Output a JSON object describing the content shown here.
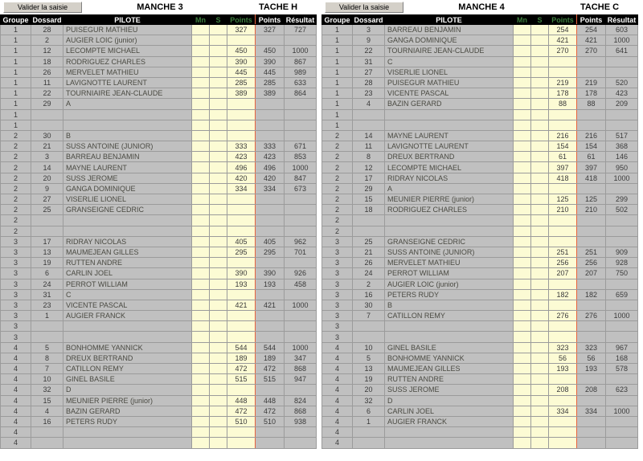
{
  "toolbar": {
    "validate_label": "Valider la saisie",
    "left_manche": "MANCHE 3",
    "left_tache": "TACHE H",
    "right_manche": "MANCHE 4",
    "right_tache": "TACHE C"
  },
  "columns": {
    "groupe": "Groupe",
    "dossard": "Dossard",
    "pilote": "PILOTE",
    "mn": "Mn",
    "s": "S",
    "points_entry": "Points",
    "points": "Points",
    "resultat": "Résultat"
  },
  "colors": {
    "header_bg": "#000000",
    "header_text": "#ffffff",
    "header_editable_text": "#3f7f3f",
    "cell_bg": "#c0c0c0",
    "input_bg": "#fcfbd4",
    "input_border": "#e8623c",
    "grid_line": "#9b9b9b",
    "button_face": "#d4d0c8"
  },
  "left_table": {
    "rows": [
      {
        "groupe": "1",
        "dossard": "28",
        "pilote": "PUISEGUR MATHIEU",
        "mn": "",
        "s": "",
        "points_entry": "327",
        "points": "327",
        "resultat": "727"
      },
      {
        "groupe": "1",
        "dossard": "2",
        "pilote": "AUGIER LOIC  (junior)",
        "mn": "",
        "s": "",
        "points_entry": "",
        "points": "",
        "resultat": ""
      },
      {
        "groupe": "1",
        "dossard": "12",
        "pilote": "LECOMPTE MICHAEL",
        "mn": "",
        "s": "",
        "points_entry": "450",
        "points": "450",
        "resultat": "1000"
      },
      {
        "groupe": "1",
        "dossard": "18",
        "pilote": "RODRIGUEZ CHARLES",
        "mn": "",
        "s": "",
        "points_entry": "390",
        "points": "390",
        "resultat": "867"
      },
      {
        "groupe": "1",
        "dossard": "26",
        "pilote": "MERVELET MATHIEU",
        "mn": "",
        "s": "",
        "points_entry": "445",
        "points": "445",
        "resultat": "989"
      },
      {
        "groupe": "1",
        "dossard": "11",
        "pilote": "LAVIGNOTTE LAURENT",
        "mn": "",
        "s": "",
        "points_entry": "285",
        "points": "285",
        "resultat": "633"
      },
      {
        "groupe": "1",
        "dossard": "22",
        "pilote": "TOURNIAIRE JEAN-CLAUDE",
        "mn": "",
        "s": "",
        "points_entry": "389",
        "points": "389",
        "resultat": "864"
      },
      {
        "groupe": "1",
        "dossard": "29",
        "pilote": "A",
        "mn": "",
        "s": "",
        "points_entry": "",
        "points": "",
        "resultat": ""
      },
      {
        "groupe": "1",
        "dossard": "",
        "pilote": "",
        "mn": "",
        "s": "",
        "points_entry": "",
        "points": "",
        "resultat": ""
      },
      {
        "groupe": "1",
        "dossard": "",
        "pilote": "",
        "mn": "",
        "s": "",
        "points_entry": "",
        "points": "",
        "resultat": ""
      },
      {
        "groupe": "2",
        "dossard": "30",
        "pilote": "B",
        "mn": "",
        "s": "",
        "points_entry": "",
        "points": "",
        "resultat": ""
      },
      {
        "groupe": "2",
        "dossard": "21",
        "pilote": "SUSS ANTOINE (JUNIOR)",
        "mn": "",
        "s": "",
        "points_entry": "333",
        "points": "333",
        "resultat": "671"
      },
      {
        "groupe": "2",
        "dossard": "3",
        "pilote": "BARREAU BENJAMIN",
        "mn": "",
        "s": "",
        "points_entry": "423",
        "points": "423",
        "resultat": "853"
      },
      {
        "groupe": "2",
        "dossard": "14",
        "pilote": "MAYNE LAURENT",
        "mn": "",
        "s": "",
        "points_entry": "496",
        "points": "496",
        "resultat": "1000"
      },
      {
        "groupe": "2",
        "dossard": "20",
        "pilote": "SUSS JEROME",
        "mn": "",
        "s": "",
        "points_entry": "420",
        "points": "420",
        "resultat": "847"
      },
      {
        "groupe": "2",
        "dossard": "9",
        "pilote": "GANGA DOMINIQUE",
        "mn": "",
        "s": "",
        "points_entry": "334",
        "points": "334",
        "resultat": "673"
      },
      {
        "groupe": "2",
        "dossard": "27",
        "pilote": "VISERLIE  LIONEL",
        "mn": "",
        "s": "",
        "points_entry": "",
        "points": "",
        "resultat": ""
      },
      {
        "groupe": "2",
        "dossard": "25",
        "pilote": "GRANSEIGNE CEDRIC",
        "mn": "",
        "s": "",
        "points_entry": "",
        "points": "",
        "resultat": ""
      },
      {
        "groupe": "2",
        "dossard": "",
        "pilote": "",
        "mn": "",
        "s": "",
        "points_entry": "",
        "points": "",
        "resultat": ""
      },
      {
        "groupe": "2",
        "dossard": "",
        "pilote": "",
        "mn": "",
        "s": "",
        "points_entry": "",
        "points": "",
        "resultat": ""
      },
      {
        "groupe": "3",
        "dossard": "17",
        "pilote": "RIDRAY NICOLAS",
        "mn": "",
        "s": "",
        "points_entry": "405",
        "points": "405",
        "resultat": "962"
      },
      {
        "groupe": "3",
        "dossard": "13",
        "pilote": "MAUMEJEAN GILLES",
        "mn": "",
        "s": "",
        "points_entry": "295",
        "points": "295",
        "resultat": "701"
      },
      {
        "groupe": "3",
        "dossard": "19",
        "pilote": "RUTTEN ANDRE",
        "mn": "",
        "s": "",
        "points_entry": "",
        "points": "",
        "resultat": ""
      },
      {
        "groupe": "3",
        "dossard": "6",
        "pilote": "CARLIN JOEL",
        "mn": "",
        "s": "",
        "points_entry": "390",
        "points": "390",
        "resultat": "926"
      },
      {
        "groupe": "3",
        "dossard": "24",
        "pilote": "PERROT  WILLIAM",
        "mn": "",
        "s": "",
        "points_entry": "193",
        "points": "193",
        "resultat": "458"
      },
      {
        "groupe": "3",
        "dossard": "31",
        "pilote": "C",
        "mn": "",
        "s": "",
        "points_entry": "",
        "points": "",
        "resultat": ""
      },
      {
        "groupe": "3",
        "dossard": "23",
        "pilote": "VICENTE PASCAL",
        "mn": "",
        "s": "",
        "points_entry": "421",
        "points": "421",
        "resultat": "1000"
      },
      {
        "groupe": "3",
        "dossard": "1",
        "pilote": "AUGIER FRANCK",
        "mn": "",
        "s": "",
        "points_entry": "",
        "points": "",
        "resultat": ""
      },
      {
        "groupe": "3",
        "dossard": "",
        "pilote": "",
        "mn": "",
        "s": "",
        "points_entry": "",
        "points": "",
        "resultat": ""
      },
      {
        "groupe": "3",
        "dossard": "",
        "pilote": "",
        "mn": "",
        "s": "",
        "points_entry": "",
        "points": "",
        "resultat": ""
      },
      {
        "groupe": "4",
        "dossard": "5",
        "pilote": "BONHOMME YANNICK",
        "mn": "",
        "s": "",
        "points_entry": "544",
        "points": "544",
        "resultat": "1000"
      },
      {
        "groupe": "4",
        "dossard": "8",
        "pilote": "DREUX BERTRAND",
        "mn": "",
        "s": "",
        "points_entry": "189",
        "points": "189",
        "resultat": "347"
      },
      {
        "groupe": "4",
        "dossard": "7",
        "pilote": "CATILLON REMY",
        "mn": "",
        "s": "",
        "points_entry": "472",
        "points": "472",
        "resultat": "868"
      },
      {
        "groupe": "4",
        "dossard": "10",
        "pilote": "GINEL BASILE",
        "mn": "",
        "s": "",
        "points_entry": "515",
        "points": "515",
        "resultat": "947"
      },
      {
        "groupe": "4",
        "dossard": "32",
        "pilote": "D",
        "mn": "",
        "s": "",
        "points_entry": "",
        "points": "",
        "resultat": ""
      },
      {
        "groupe": "4",
        "dossard": "15",
        "pilote": "MEUNIER PIERRE (junior)",
        "mn": "",
        "s": "",
        "points_entry": "448",
        "points": "448",
        "resultat": "824"
      },
      {
        "groupe": "4",
        "dossard": "4",
        "pilote": "BAZIN GERARD",
        "mn": "",
        "s": "",
        "points_entry": "472",
        "points": "472",
        "resultat": "868"
      },
      {
        "groupe": "4",
        "dossard": "16",
        "pilote": "PETERS RUDY",
        "mn": "",
        "s": "",
        "points_entry": "510",
        "points": "510",
        "resultat": "938"
      },
      {
        "groupe": "4",
        "dossard": "",
        "pilote": "",
        "mn": "",
        "s": "",
        "points_entry": "",
        "points": "",
        "resultat": ""
      },
      {
        "groupe": "4",
        "dossard": "",
        "pilote": "",
        "mn": "",
        "s": "",
        "points_entry": "",
        "points": "",
        "resultat": ""
      }
    ]
  },
  "right_table": {
    "rows": [
      {
        "groupe": "1",
        "dossard": "3",
        "pilote": "BARREAU BENJAMIN",
        "mn": "",
        "s": "",
        "points_entry": "254",
        "points": "254",
        "resultat": "603"
      },
      {
        "groupe": "1",
        "dossard": "9",
        "pilote": "GANGA DOMINIQUE",
        "mn": "",
        "s": "",
        "points_entry": "421",
        "points": "421",
        "resultat": "1000"
      },
      {
        "groupe": "1",
        "dossard": "22",
        "pilote": "TOURNIAIRE JEAN-CLAUDE",
        "mn": "",
        "s": "",
        "points_entry": "270",
        "points": "270",
        "resultat": "641"
      },
      {
        "groupe": "1",
        "dossard": "31",
        "pilote": "C",
        "mn": "",
        "s": "",
        "points_entry": "",
        "points": "",
        "resultat": ""
      },
      {
        "groupe": "1",
        "dossard": "27",
        "pilote": "VISERLIE  LIONEL",
        "mn": "",
        "s": "",
        "points_entry": "",
        "points": "",
        "resultat": ""
      },
      {
        "groupe": "1",
        "dossard": "28",
        "pilote": "PUISEGUR MATHIEU",
        "mn": "",
        "s": "",
        "points_entry": "219",
        "points": "219",
        "resultat": "520"
      },
      {
        "groupe": "1",
        "dossard": "23",
        "pilote": "VICENTE PASCAL",
        "mn": "",
        "s": "",
        "points_entry": "178",
        "points": "178",
        "resultat": "423"
      },
      {
        "groupe": "1",
        "dossard": "4",
        "pilote": "BAZIN GERARD",
        "mn": "",
        "s": "",
        "points_entry": "88",
        "points": "88",
        "resultat": "209"
      },
      {
        "groupe": "1",
        "dossard": "",
        "pilote": "",
        "mn": "",
        "s": "",
        "points_entry": "",
        "points": "",
        "resultat": ""
      },
      {
        "groupe": "1",
        "dossard": "",
        "pilote": "",
        "mn": "",
        "s": "",
        "points_entry": "",
        "points": "",
        "resultat": ""
      },
      {
        "groupe": "2",
        "dossard": "14",
        "pilote": "MAYNE LAURENT",
        "mn": "",
        "s": "",
        "points_entry": "216",
        "points": "216",
        "resultat": "517"
      },
      {
        "groupe": "2",
        "dossard": "11",
        "pilote": "LAVIGNOTTE LAURENT",
        "mn": "",
        "s": "",
        "points_entry": "154",
        "points": "154",
        "resultat": "368"
      },
      {
        "groupe": "2",
        "dossard": "8",
        "pilote": "DREUX BERTRAND",
        "mn": "",
        "s": "",
        "points_entry": "61",
        "points": "61",
        "resultat": "146"
      },
      {
        "groupe": "2",
        "dossard": "12",
        "pilote": "LECOMPTE MICHAEL",
        "mn": "",
        "s": "",
        "points_entry": "397",
        "points": "397",
        "resultat": "950"
      },
      {
        "groupe": "2",
        "dossard": "17",
        "pilote": "RIDRAY NICOLAS",
        "mn": "",
        "s": "",
        "points_entry": "418",
        "points": "418",
        "resultat": "1000"
      },
      {
        "groupe": "2",
        "dossard": "29",
        "pilote": "A",
        "mn": "",
        "s": "",
        "points_entry": "",
        "points": "",
        "resultat": ""
      },
      {
        "groupe": "2",
        "dossard": "15",
        "pilote": "MEUNIER PIERRE (junior)",
        "mn": "",
        "s": "",
        "points_entry": "125",
        "points": "125",
        "resultat": "299"
      },
      {
        "groupe": "2",
        "dossard": "18",
        "pilote": "RODRIGUEZ CHARLES",
        "mn": "",
        "s": "",
        "points_entry": "210",
        "points": "210",
        "resultat": "502"
      },
      {
        "groupe": "2",
        "dossard": "",
        "pilote": "",
        "mn": "",
        "s": "",
        "points_entry": "",
        "points": "",
        "resultat": ""
      },
      {
        "groupe": "2",
        "dossard": "",
        "pilote": "",
        "mn": "",
        "s": "",
        "points_entry": "",
        "points": "",
        "resultat": ""
      },
      {
        "groupe": "3",
        "dossard": "25",
        "pilote": "GRANSEIGNE CEDRIC",
        "mn": "",
        "s": "",
        "points_entry": "",
        "points": "",
        "resultat": ""
      },
      {
        "groupe": "3",
        "dossard": "21",
        "pilote": "SUSS ANTOINE (JUNIOR)",
        "mn": "",
        "s": "",
        "points_entry": "251",
        "points": "251",
        "resultat": "909"
      },
      {
        "groupe": "3",
        "dossard": "26",
        "pilote": "MERVELET MATHIEU",
        "mn": "",
        "s": "",
        "points_entry": "256",
        "points": "256",
        "resultat": "928"
      },
      {
        "groupe": "3",
        "dossard": "24",
        "pilote": "PERROT  WILLIAM",
        "mn": "",
        "s": "",
        "points_entry": "207",
        "points": "207",
        "resultat": "750"
      },
      {
        "groupe": "3",
        "dossard": "2",
        "pilote": "AUGIER LOIC  (junior)",
        "mn": "",
        "s": "",
        "points_entry": "",
        "points": "",
        "resultat": ""
      },
      {
        "groupe": "3",
        "dossard": "16",
        "pilote": "PETERS RUDY",
        "mn": "",
        "s": "",
        "points_entry": "182",
        "points": "182",
        "resultat": "659"
      },
      {
        "groupe": "3",
        "dossard": "30",
        "pilote": "B",
        "mn": "",
        "s": "",
        "points_entry": "",
        "points": "",
        "resultat": ""
      },
      {
        "groupe": "3",
        "dossard": "7",
        "pilote": "CATILLON REMY",
        "mn": "",
        "s": "",
        "points_entry": "276",
        "points": "276",
        "resultat": "1000"
      },
      {
        "groupe": "3",
        "dossard": "",
        "pilote": "",
        "mn": "",
        "s": "",
        "points_entry": "",
        "points": "",
        "resultat": ""
      },
      {
        "groupe": "3",
        "dossard": "",
        "pilote": "",
        "mn": "",
        "s": "",
        "points_entry": "",
        "points": "",
        "resultat": ""
      },
      {
        "groupe": "4",
        "dossard": "10",
        "pilote": "GINEL BASILE",
        "mn": "",
        "s": "",
        "points_entry": "323",
        "points": "323",
        "resultat": "967"
      },
      {
        "groupe": "4",
        "dossard": "5",
        "pilote": "BONHOMME YANNICK",
        "mn": "",
        "s": "",
        "points_entry": "56",
        "points": "56",
        "resultat": "168"
      },
      {
        "groupe": "4",
        "dossard": "13",
        "pilote": "MAUMEJEAN GILLES",
        "mn": "",
        "s": "",
        "points_entry": "193",
        "points": "193",
        "resultat": "578"
      },
      {
        "groupe": "4",
        "dossard": "19",
        "pilote": "RUTTEN ANDRE",
        "mn": "",
        "s": "",
        "points_entry": "",
        "points": "",
        "resultat": ""
      },
      {
        "groupe": "4",
        "dossard": "20",
        "pilote": "SUSS JEROME",
        "mn": "",
        "s": "",
        "points_entry": "208",
        "points": "208",
        "resultat": "623"
      },
      {
        "groupe": "4",
        "dossard": "32",
        "pilote": "D",
        "mn": "",
        "s": "",
        "points_entry": "",
        "points": "",
        "resultat": ""
      },
      {
        "groupe": "4",
        "dossard": "6",
        "pilote": "CARLIN JOEL",
        "mn": "",
        "s": "",
        "points_entry": "334",
        "points": "334",
        "resultat": "1000"
      },
      {
        "groupe": "4",
        "dossard": "1",
        "pilote": "AUGIER FRANCK",
        "mn": "",
        "s": "",
        "points_entry": "",
        "points": "",
        "resultat": ""
      },
      {
        "groupe": "4",
        "dossard": "",
        "pilote": "",
        "mn": "",
        "s": "",
        "points_entry": "",
        "points": "",
        "resultat": ""
      },
      {
        "groupe": "4",
        "dossard": "",
        "pilote": "",
        "mn": "",
        "s": "",
        "points_entry": "",
        "points": "",
        "resultat": ""
      }
    ]
  }
}
